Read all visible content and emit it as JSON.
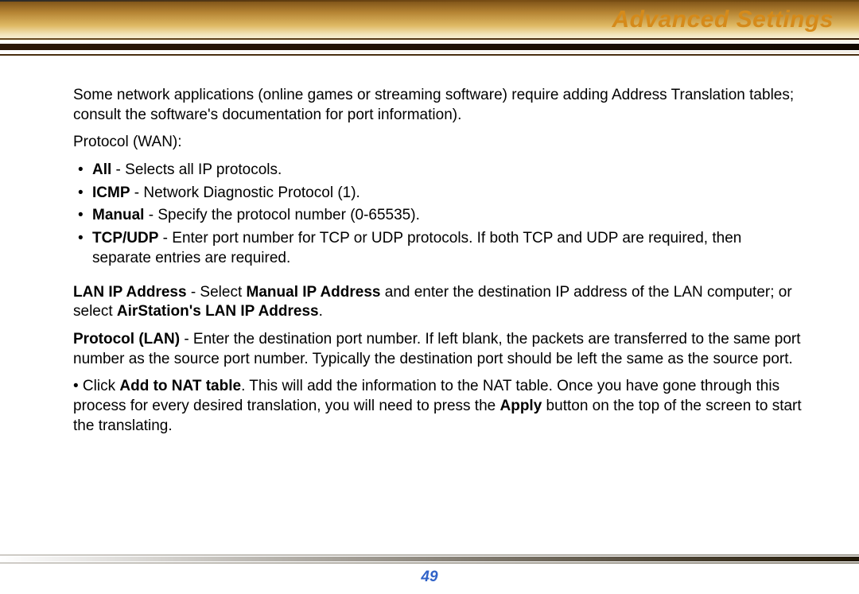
{
  "header": {
    "title": "Advanced Settings"
  },
  "intro": "Some network applications (online games or streaming software) require adding Address Translation tables; consult the software's documentation for port information).",
  "protocol_wan_label": "Protocol (WAN):",
  "bullets": {
    "all": {
      "name": "All",
      "desc": " - Selects all IP protocols."
    },
    "icmp": {
      "name": "ICMP",
      "desc": " - Network Diagnostic Protocol (1)."
    },
    "manual": {
      "name": "Manual",
      "desc": " - Specify the protocol number (0-65535)."
    },
    "tcpudp": {
      "name": "TCP/UDP",
      "desc": " - Enter port number for TCP or UDP protocols.  If both TCP and UDP are required, then separate entries are required."
    }
  },
  "lan_ip": {
    "label": "LAN IP Address",
    "t1": " - Select ",
    "b1": "Manual IP Address",
    "t2": " and enter the destination IP address of the LAN computer; or select ",
    "b2": "AirStation's LAN IP Address",
    "t3": "."
  },
  "protocol_lan": {
    "label": "Protocol (LAN)",
    "desc": " - Enter the destination port number.  If left blank, the packets are transferred to the same port number as the source port number.  Typically the destination port should be left the same as the source port."
  },
  "nat": {
    "prefix": "• Click ",
    "b1": "Add to NAT table",
    "t1": ".  This will add the information to the NAT table.  Once you have gone through this process for every desired translation, you will need to press the ",
    "b2": "Apply",
    "t2": " button on the top of the screen to start the translating."
  },
  "page_number": "49"
}
